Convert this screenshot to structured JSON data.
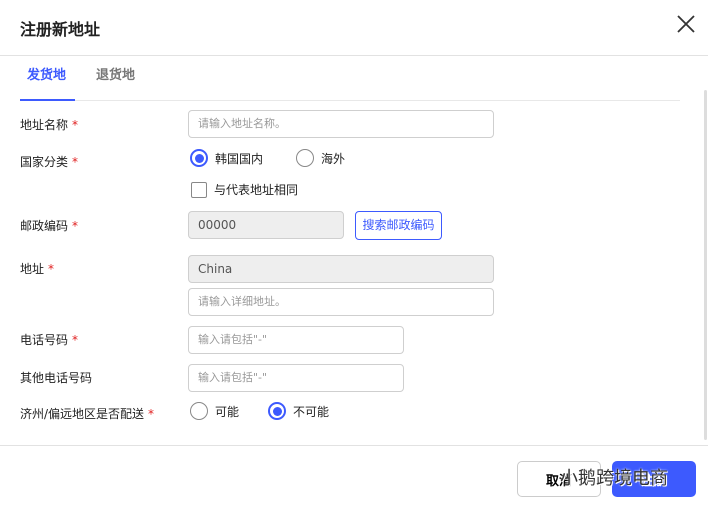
{
  "dialog": {
    "title": "注册新地址"
  },
  "tabs": [
    {
      "label": "发货地"
    },
    {
      "label": "退货地"
    }
  ],
  "form": {
    "address_name": {
      "label": "地址名称",
      "required": "*",
      "placeholder": "请输入地址名称。"
    },
    "country_type": {
      "label": "国家分类",
      "required": "*",
      "options": [
        {
          "label": "韩国国内",
          "selected": true
        },
        {
          "label": "海外",
          "selected": false
        }
      ],
      "checkbox_label": "与代表地址相同"
    },
    "postal_code": {
      "label": "邮政编码",
      "required": "*",
      "value": "00000",
      "search_button": "搜索邮政编码"
    },
    "address": {
      "label": "地址",
      "required": "*",
      "value": "China",
      "detail_placeholder": "请输入详细地址。"
    },
    "phone": {
      "label": "电话号码",
      "required": "*",
      "placeholder": "输入请包括\"-\""
    },
    "other_phone": {
      "label": "其他电话号码",
      "placeholder": "输入请包括\"-\""
    },
    "remote_delivery": {
      "label": "济州/偏远地区是否配送",
      "required": "*",
      "options": [
        {
          "label": "可能",
          "selected": false
        },
        {
          "label": "不可能",
          "selected": true
        }
      ]
    }
  },
  "footer": {
    "cancel": "取消",
    "submit": "注册"
  },
  "watermark": "小鹅跨境电商",
  "colors": {
    "accent": "#3d5afe",
    "required": "#e02020"
  }
}
